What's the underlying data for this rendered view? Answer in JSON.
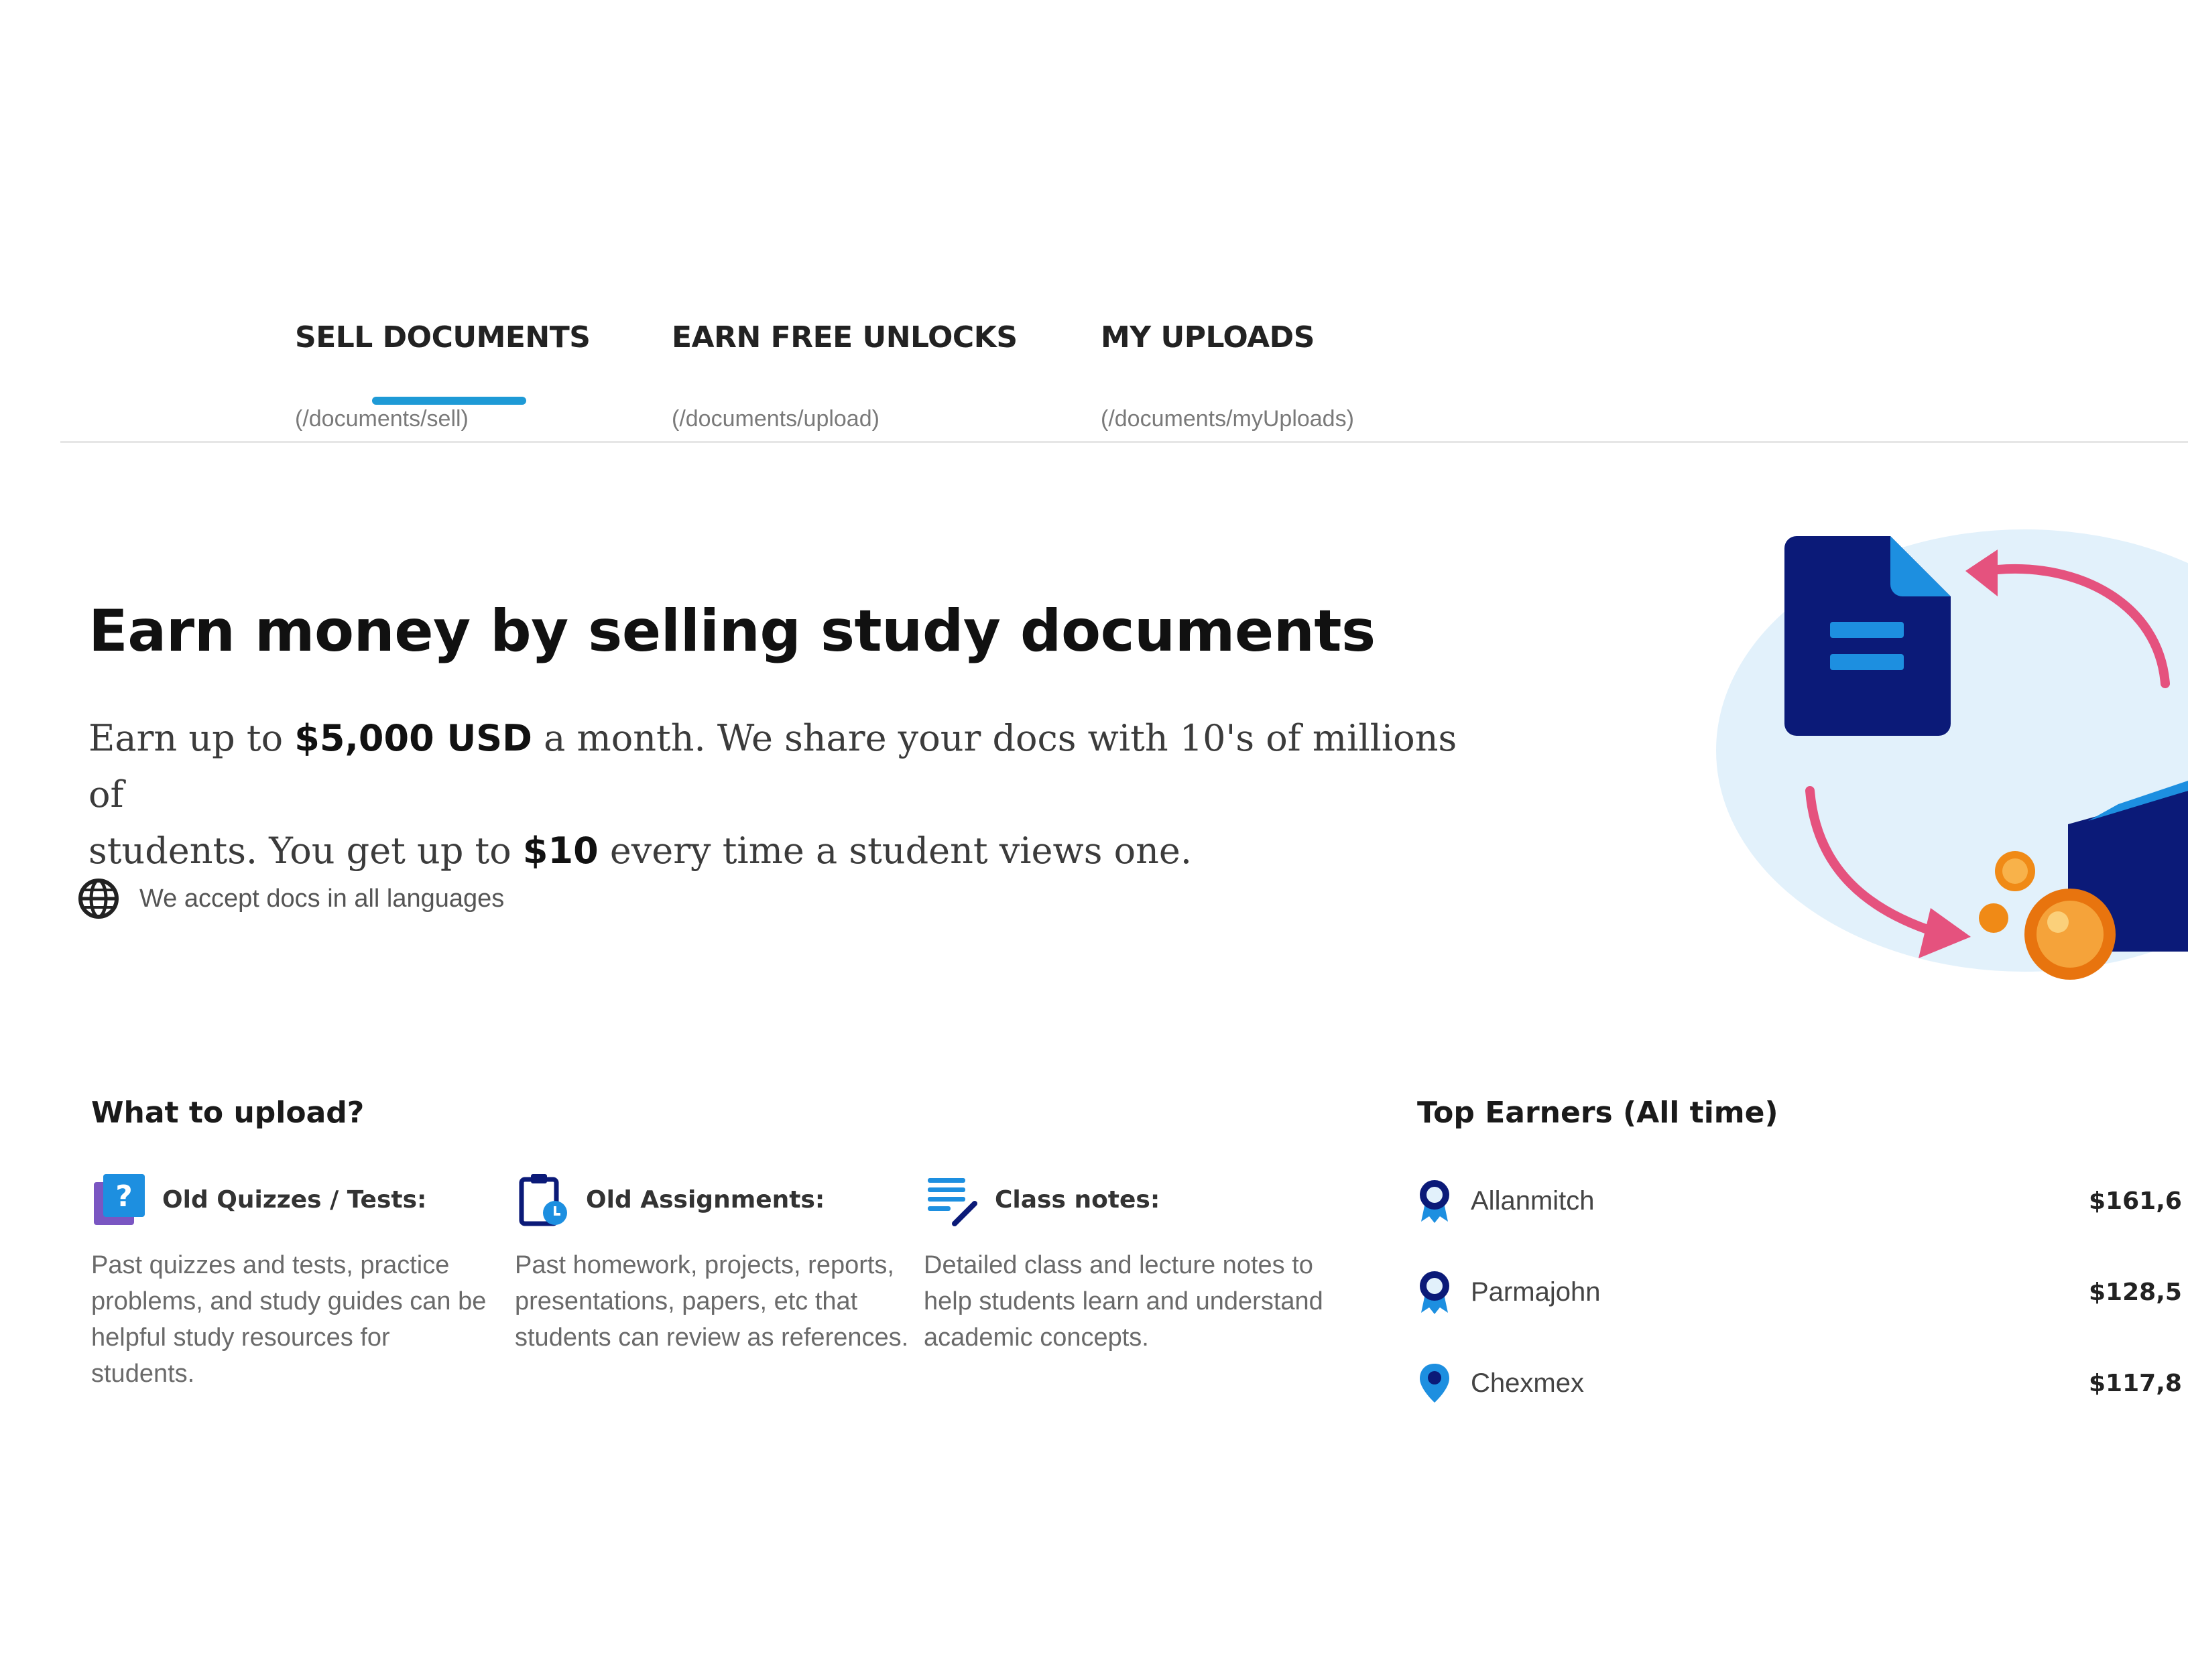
{
  "theme": {
    "accent": "#1e9ad6",
    "navy": "#0b1a78",
    "doc_blue": "#1d8fe0",
    "pink": "#e5527e",
    "coin": "#f08a16",
    "bubble": "#e2f1fb"
  },
  "tabs": [
    {
      "label": "SELL DOCUMENTS",
      "url": "(/documents/sell)",
      "active": true
    },
    {
      "label": "EARN FREE UNLOCKS",
      "url": "(/documents/upload)",
      "active": false
    },
    {
      "label": "MY UPLOADS",
      "url": "(/documents/myUploads)",
      "active": false
    }
  ],
  "hero": {
    "title": "Earn money by selling study documents",
    "line1_a": "Earn up to ",
    "line1_b": "$5,000 USD",
    "line1_c": " a month. We share your docs with 10's of millions of",
    "line2_a": "students. You get up to ",
    "line2_b": "$10",
    "line2_c": " every time a student views one.",
    "languages_note": "We accept docs in all languages",
    "languages_icon": "globe-icon"
  },
  "what_to_upload": {
    "heading": "What to upload?",
    "categories": [
      {
        "icon": "quiz-icon",
        "title": "Old Quizzes / Tests:",
        "description": "Past quizzes and tests, practice problems, and study guides can be helpful study resources for students."
      },
      {
        "icon": "assignment-icon",
        "title": "Old Assignments:",
        "description": "Past homework, projects, reports, presentations, papers, etc that students can review as references."
      },
      {
        "icon": "notes-icon",
        "title": "Class notes:",
        "description": "Detailed class and lecture notes to help students learn and understand academic concepts."
      }
    ]
  },
  "top_earners": {
    "heading": "Top Earners (All time)",
    "rows": [
      {
        "icon": "award-icon",
        "name": "Allanmitch",
        "amount": "$161,6"
      },
      {
        "icon": "award-icon",
        "name": "Parmajohn",
        "amount": "$128,5"
      },
      {
        "icon": "location-icon",
        "name": "Chexmex",
        "amount": "$117,8"
      }
    ]
  }
}
